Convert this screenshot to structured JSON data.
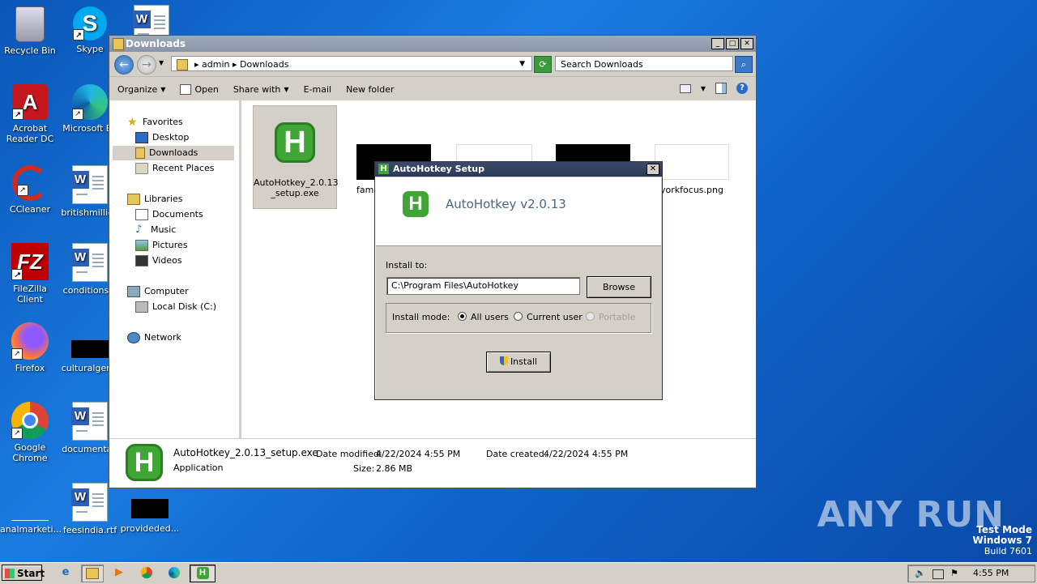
{
  "desktop": {
    "icons": [
      {
        "label": "Recycle Bin"
      },
      {
        "label": "Skype"
      },
      {
        "label": "Acrobat Reader DC"
      },
      {
        "label": "Microsoft Ed"
      },
      {
        "label": "CCleaner"
      },
      {
        "label": "britishmillion"
      },
      {
        "label": "FileZilla Client"
      },
      {
        "label": "conditionsgi"
      },
      {
        "label": "Firefox"
      },
      {
        "label": "culturalgerm"
      },
      {
        "label": "Google Chrome"
      },
      {
        "label": "documentati"
      },
      {
        "label": "analmarketi..."
      },
      {
        "label": "feesindia.rtf"
      },
      {
        "label": "provideded..."
      }
    ]
  },
  "explorer": {
    "title": "Downloads",
    "breadcrumb": [
      "admin",
      "Downloads"
    ],
    "search_placeholder": "Search Downloads",
    "toolbar": {
      "organize": "Organize",
      "open": "Open",
      "share_with": "Share with",
      "email": "E-mail",
      "new_folder": "New folder"
    },
    "nav": {
      "favorites": "Favorites",
      "desktop": "Desktop",
      "downloads": "Downloads",
      "recent": "Recent Places",
      "libraries": "Libraries",
      "documents": "Documents",
      "music": "Music",
      "pictures": "Pictures",
      "videos": "Videos",
      "computer": "Computer",
      "local_disk": "Local Disk (C:)",
      "network": "Network"
    },
    "files": {
      "selected": "AutoHotkey_2.0.13\n_setup.exe",
      "fam": "fam",
      "york": "yorkfocus.png"
    },
    "details": {
      "name": "AutoHotkey_2.0.13_setup.exe",
      "type": "Application",
      "modified_label": "Date modified:",
      "modified": "4/22/2024 4:55 PM",
      "size_label": "Size:",
      "size": "2.86 MB",
      "created_label": "Date created:",
      "created": "4/22/2024 4:55 PM"
    }
  },
  "setup": {
    "title": "AutoHotkey Setup",
    "heading": "AutoHotkey v2.0.13",
    "install_to_label": "Install to:",
    "path": "C:\\Program Files\\AutoHotkey",
    "browse": "Browse",
    "mode_label": "Install mode:",
    "modes": [
      "All users",
      "Current user",
      "Portable"
    ],
    "install": "Install"
  },
  "taskbar": {
    "start": "Start",
    "clock": "4:55 PM"
  },
  "watermark": {
    "brand": "ANY RUN",
    "line1": "Test Mode",
    "line2": "Windows 7",
    "line3": "Build 7601"
  },
  "colors": {
    "ahk_green": "#3fa535",
    "desktop_blue": "#1a7be0"
  }
}
